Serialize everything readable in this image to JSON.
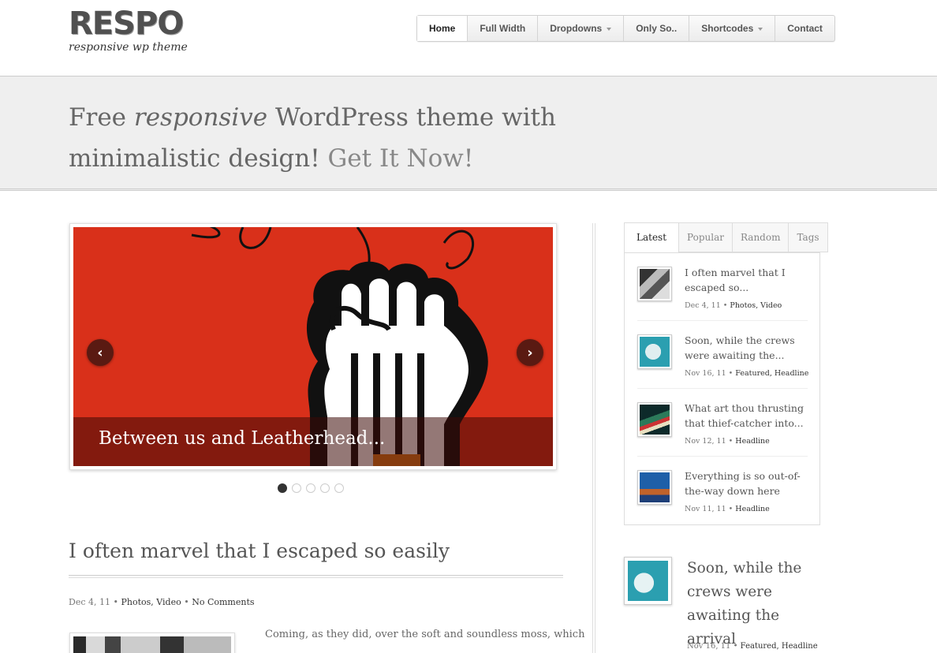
{
  "logo": {
    "title": "RESPO",
    "tagline": "responsive wp theme"
  },
  "nav": {
    "items": [
      {
        "label": "Home",
        "active": true,
        "dropdown": false
      },
      {
        "label": "Full Width",
        "active": false,
        "dropdown": false
      },
      {
        "label": "Dropdowns",
        "active": false,
        "dropdown": true
      },
      {
        "label": "Only So..",
        "active": false,
        "dropdown": false
      },
      {
        "label": "Shortcodes",
        "active": false,
        "dropdown": true
      },
      {
        "label": "Contact",
        "active": false,
        "dropdown": false
      }
    ]
  },
  "hero": {
    "part1": "Free ",
    "emphasis": "responsive",
    "part2": " WordPress theme with minimalistic design! ",
    "cta": "Get It Now!"
  },
  "slider": {
    "caption": "Between us and Leatherhead...",
    "prev_icon": "chevron-left-icon",
    "next_icon": "chevron-right-icon",
    "dots": 5,
    "active_dot": 0,
    "colors": {
      "background": "#d9301a"
    }
  },
  "post": {
    "title": "I often marvel that I escaped so easily",
    "date": "Dec 4, 11",
    "sep": " • ",
    "category1": "Photos",
    "category2": "Video",
    "comments": "No Comments",
    "excerpt": "Coming, as they did, over the soft and soundless moss, which"
  },
  "sidebar": {
    "tabs": [
      "Latest",
      "Popular",
      "Random",
      "Tags"
    ],
    "active_tab": 0,
    "items": [
      {
        "title": "I often marvel that I escaped so...",
        "date": "Dec 4, 11",
        "sep": " • ",
        "cat1": "Photos",
        "comma": ", ",
        "cat2": "Video"
      },
      {
        "title": "Soon, while the crews were awaiting the...",
        "date": "Nov 16, 11",
        "sep": " • ",
        "cat1": "Featured",
        "comma": ", ",
        "cat2": "Headline"
      },
      {
        "title": "What art thou thrusting that thief-catcher into...",
        "date": "Nov 12, 11",
        "sep": " • ",
        "cat1": "Headline",
        "comma": "",
        "cat2": ""
      },
      {
        "title": "Everything is so out-of-the-way down here",
        "date": "Nov 11, 11",
        "sep": " • ",
        "cat1": "Headline",
        "comma": "",
        "cat2": ""
      }
    ],
    "featured": {
      "title": "Soon, while the crews were awaiting the arrival",
      "date": "Nov 16, 11",
      "sep": " • ",
      "cat1": "Featured",
      "comma": ", ",
      "cat2": "Headline"
    }
  }
}
